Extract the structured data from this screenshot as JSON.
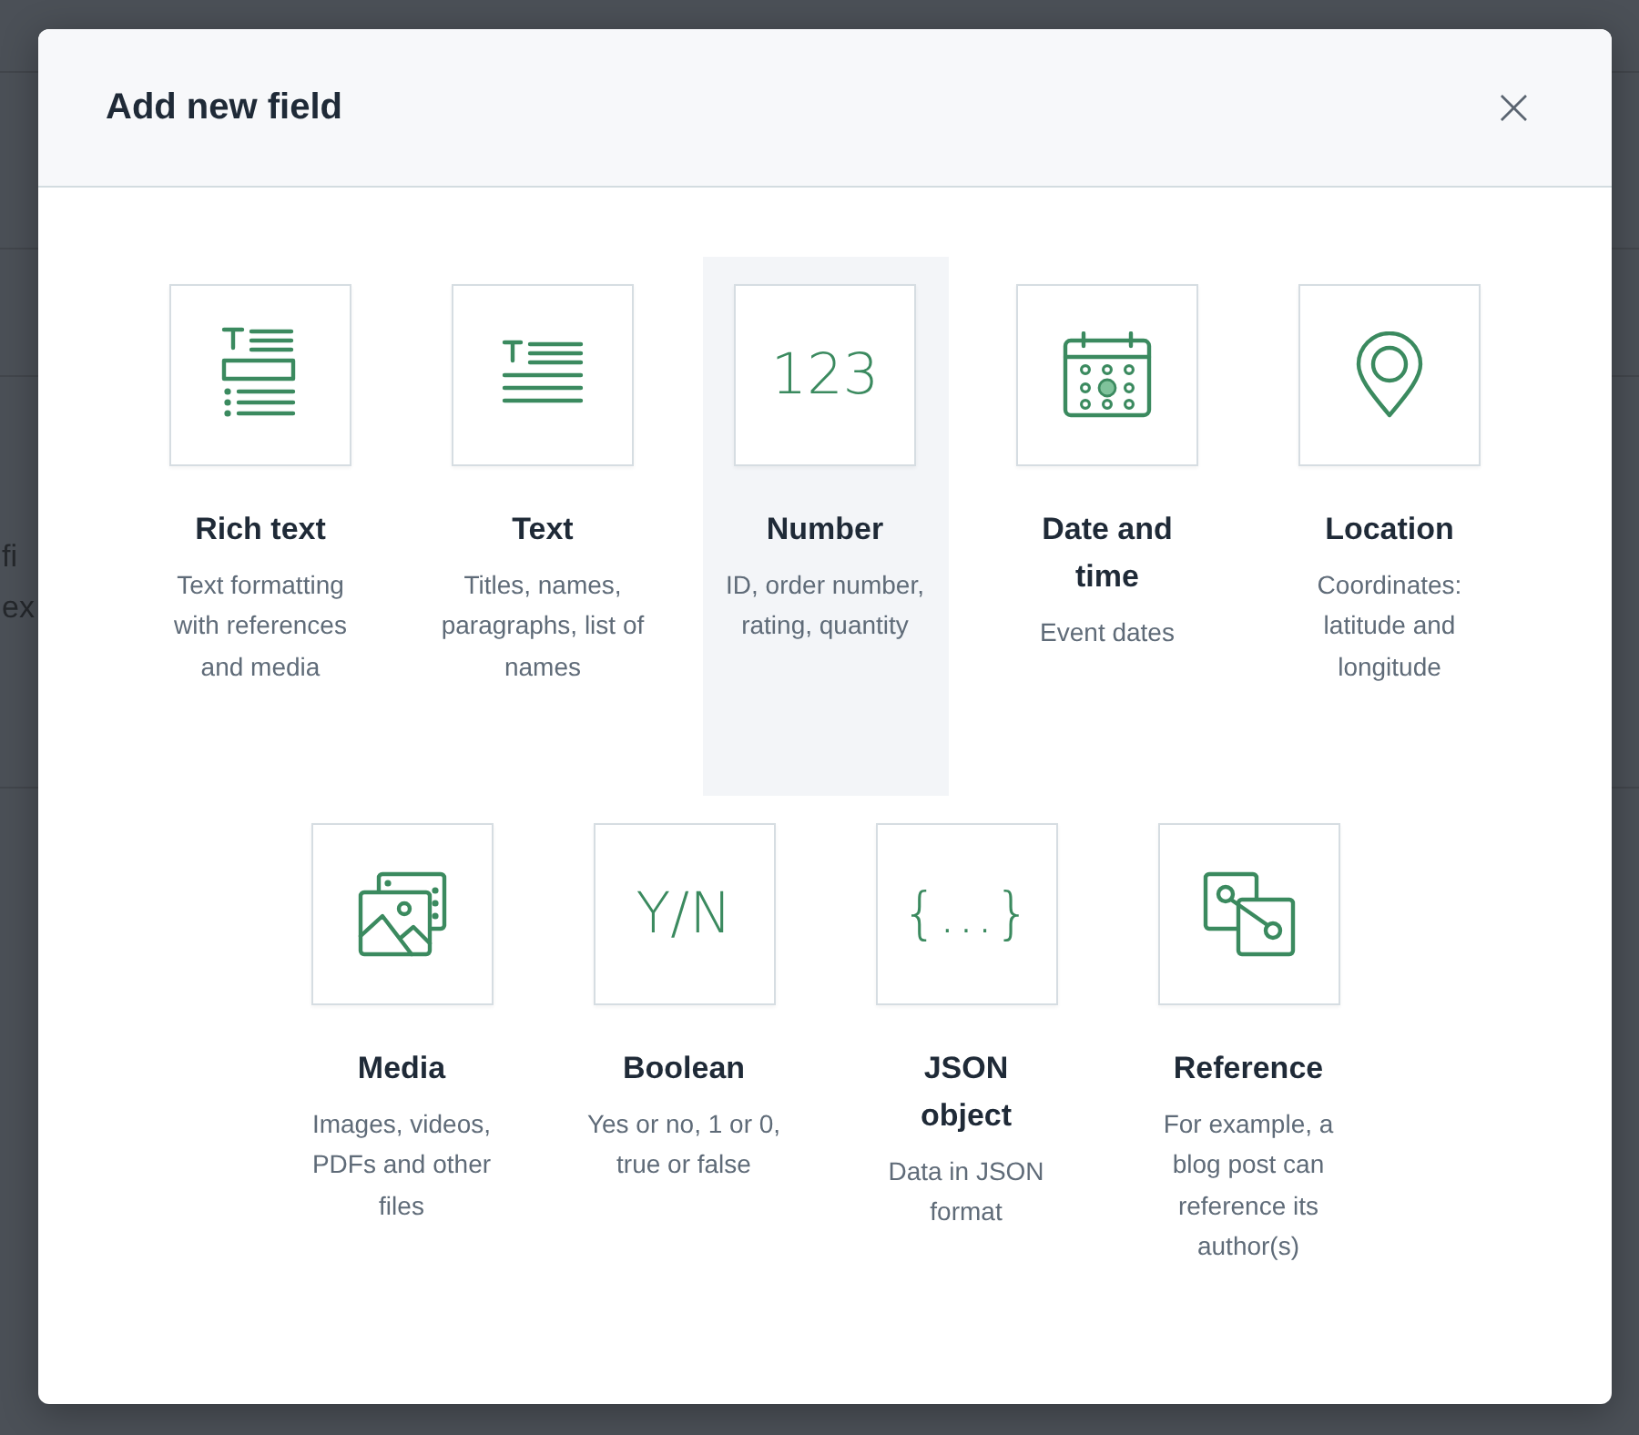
{
  "background_text": [
    "fi",
    "ex"
  ],
  "dialog": {
    "title": "Add new field",
    "close": "×"
  },
  "fields": [
    {
      "kind": "richtext",
      "name": "Rich text",
      "description": "Text formatting with references and media",
      "selected": false
    },
    {
      "kind": "text",
      "name": "Text",
      "description": "Titles, names, paragraphs, list of names",
      "selected": false
    },
    {
      "kind": "glyph",
      "glyph": "123",
      "name": "Number",
      "description": "ID, order number, rating, quantity",
      "selected": true
    },
    {
      "kind": "calendar",
      "name": "Date and time",
      "description": "Event dates",
      "selected": false
    },
    {
      "kind": "location",
      "name": "Location",
      "description": "Coordinates: latitude and longitude",
      "selected": false
    },
    {
      "kind": "media",
      "name": "Media",
      "description": "Images, videos, PDFs and other files",
      "selected": false
    },
    {
      "kind": "glyph",
      "glyph": "Y/N",
      "name": "Boolean",
      "description": "Yes or no, 1 or 0, true or false",
      "selected": false
    },
    {
      "kind": "glyph",
      "glyph": "{…}",
      "name": "JSON object",
      "description": "Data in JSON format",
      "selected": false
    },
    {
      "kind": "reference",
      "name": "Reference",
      "description": "For example, a blog post can reference its author(s)",
      "selected": false
    }
  ]
}
